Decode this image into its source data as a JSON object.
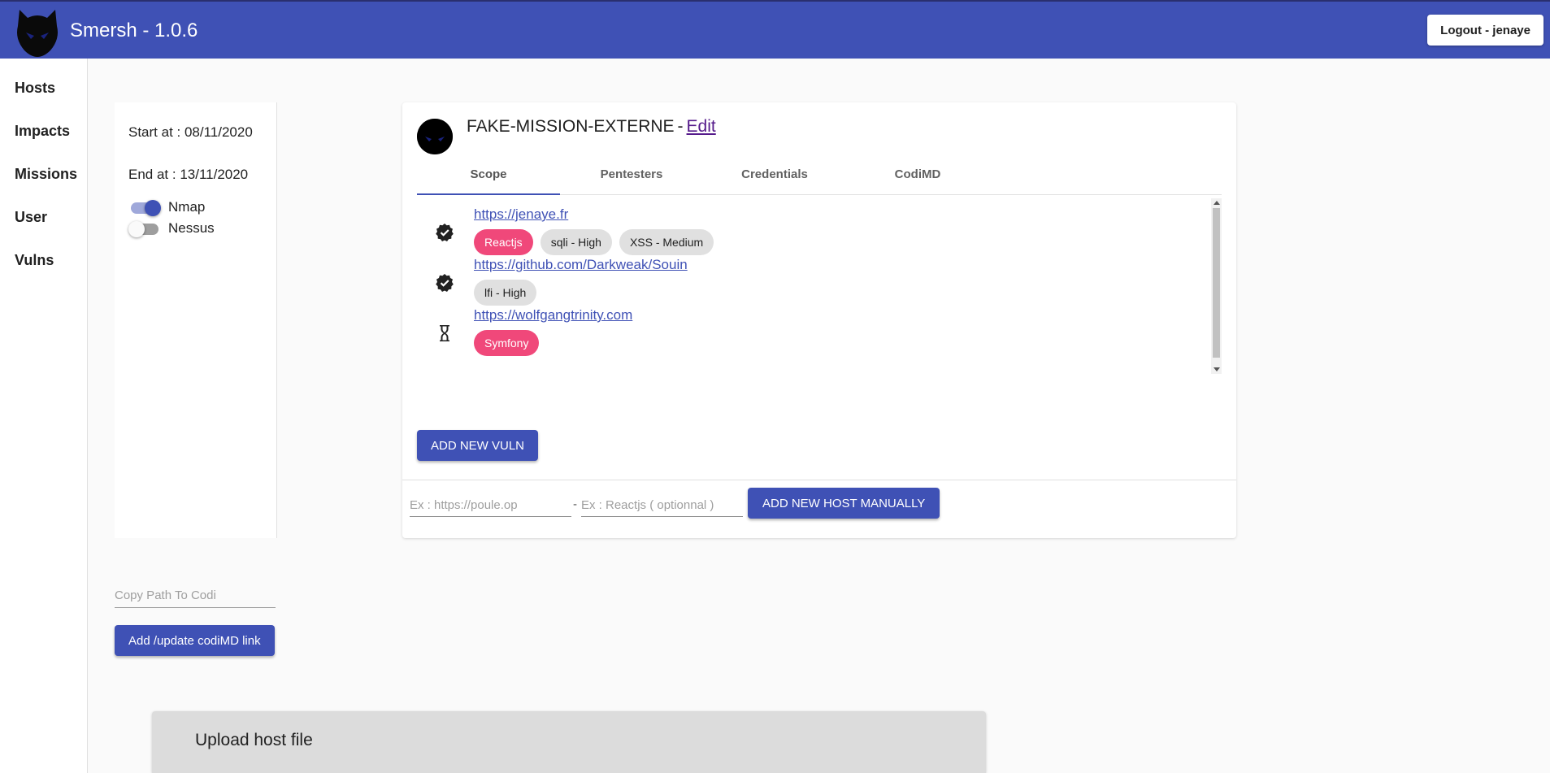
{
  "app": {
    "title": "Smersh - 1.0.6",
    "logout_label": "Logout - jenaye"
  },
  "sidebar": {
    "items": [
      {
        "label": "Hosts"
      },
      {
        "label": "Impacts"
      },
      {
        "label": "Missions"
      },
      {
        "label": "User"
      },
      {
        "label": "Vulns"
      }
    ]
  },
  "mission": {
    "start": "Start at : 08/11/2020",
    "end": "End at : 13/11/2020",
    "toggles": [
      {
        "label": "Nmap",
        "checked": true
      },
      {
        "label": "Nessus",
        "checked": false
      }
    ],
    "name": "FAKE-MISSION-EXTERNE",
    "separator": "-",
    "edit_label": "Edit"
  },
  "tabs": [
    {
      "label": "Scope",
      "active": true
    },
    {
      "label": "Pentesters",
      "active": false
    },
    {
      "label": "Credentials",
      "active": false
    },
    {
      "label": "CodiMD",
      "active": false
    }
  ],
  "hosts": [
    {
      "url": "https://jenaye.fr",
      "status": "checked-badge-icon",
      "chips": [
        {
          "label": "Reactjs",
          "kind": "tech"
        },
        {
          "label": "sqli - High",
          "kind": "vuln"
        },
        {
          "label": "XSS - Medium",
          "kind": "vuln"
        }
      ]
    },
    {
      "url": "https://github.com/Darkweak/Souin",
      "status": "checked-badge-icon",
      "chips": [
        {
          "label": "lfi - High",
          "kind": "vuln"
        }
      ]
    },
    {
      "url": "https://wolfgangtrinity.com",
      "status": "hourglass-icon",
      "chips": [
        {
          "label": "Symfony",
          "kind": "tech"
        }
      ]
    }
  ],
  "actions": {
    "add_vuln": "ADD NEW VULN",
    "host_placeholder": "Ex : https://poule.op",
    "dash": "-",
    "tech_placeholder": "Ex : Reactjs ( optionnal )",
    "add_host": "ADD NEW HOST MANUALLY"
  },
  "codimd": {
    "placeholder": "Copy Path To Codi",
    "button": "Add /update codiMD link"
  },
  "upload": {
    "title": "Upload host file"
  },
  "colors": {
    "primary": "#3f51b5",
    "tech_chip": "#f0487a",
    "vuln_chip": "#e0e0e0"
  }
}
